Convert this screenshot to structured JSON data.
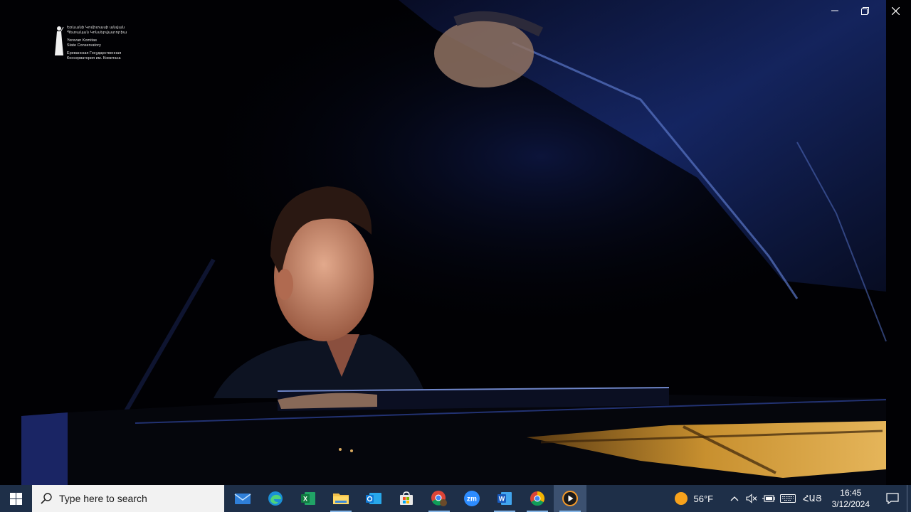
{
  "window": {
    "minimize_label": "minimize",
    "restore_label": "restore",
    "close_label": "close"
  },
  "watermark": {
    "lines_armenian": [
      "Երևանի Կոմիտասի անվան",
      "Պետական Կոնսերվատորիա"
    ],
    "lines_english": [
      "Yerevan Komitas",
      "State Conservatory"
    ],
    "lines_russian": [
      "Ереванская Государственная",
      "Консерватория им. Комитаса"
    ]
  },
  "taskbar": {
    "search_placeholder": "Type here to search",
    "apps": [
      {
        "name": "mail",
        "running": false,
        "active": false
      },
      {
        "name": "edge",
        "running": false,
        "active": false
      },
      {
        "name": "excel",
        "running": false,
        "active": false
      },
      {
        "name": "file-explorer",
        "running": true,
        "active": false
      },
      {
        "name": "outlook",
        "running": false,
        "active": false
      },
      {
        "name": "store",
        "running": false,
        "active": false
      },
      {
        "name": "chrome-profile",
        "running": true,
        "active": false
      },
      {
        "name": "zoom",
        "running": false,
        "active": false
      },
      {
        "name": "word",
        "running": true,
        "active": false
      },
      {
        "name": "chrome",
        "running": true,
        "active": false
      },
      {
        "name": "media-player",
        "running": true,
        "active": true
      }
    ],
    "weather": {
      "temp": "56°F"
    },
    "language": "ՀԱՅ",
    "clock": {
      "time": "16:45",
      "date": "3/12/2024"
    }
  },
  "colors": {
    "taskbar": "#1e2f48",
    "search_bg": "#f2f2f2",
    "accent": "#86b7e8"
  }
}
